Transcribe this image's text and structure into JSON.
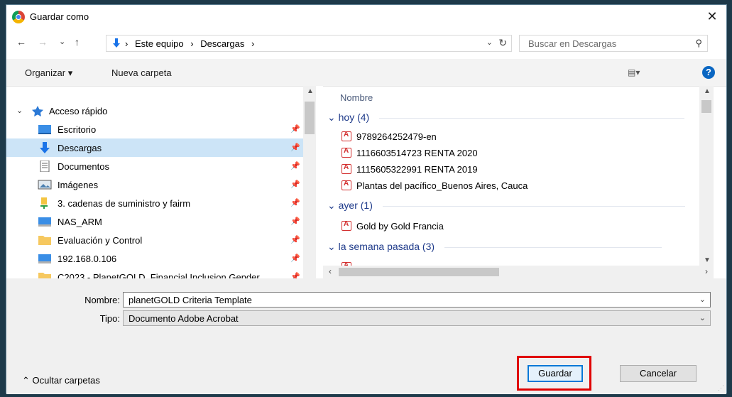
{
  "window": {
    "title": "Guardar como",
    "close_glyph": "✕"
  },
  "nav": {
    "back": "←",
    "forward": "→",
    "recent": "⌄",
    "up": "↑",
    "breadcrumb": [
      "Este equipo",
      "Descargas"
    ],
    "sep": "›",
    "dropdown": "⌄",
    "refresh": "↻"
  },
  "search": {
    "placeholder": "Buscar en Descargas"
  },
  "toolbar": {
    "organize": "Organizar ▾",
    "new_folder": "Nueva carpeta",
    "view": "▤▾",
    "help": "?"
  },
  "sidebar": {
    "quick_access": "Acceso rápido",
    "items": [
      {
        "label": "Escritorio",
        "icon": "desktop-icon"
      },
      {
        "label": "Descargas",
        "icon": "download-folder-icon",
        "selected": true
      },
      {
        "label": "Documentos",
        "icon": "documents-icon"
      },
      {
        "label": "Imágenes",
        "icon": "images-icon"
      },
      {
        "label": "3. cadenas de suministro y fairm",
        "icon": "folder-green-icon"
      },
      {
        "label": "NAS_ARM",
        "icon": "network-drive-icon"
      },
      {
        "label": "Evaluación y Control",
        "icon": "folder-icon"
      },
      {
        "label": "192.168.0.106",
        "icon": "network-drive-icon"
      },
      {
        "label": "C2023 - PlanetGOLD_Financial Inclusion Gender",
        "icon": "folder-icon"
      }
    ]
  },
  "files": {
    "column": "Nombre",
    "groups": [
      {
        "label": "hoy (4)",
        "items": [
          "9789264252479-en",
          "1116603514723 RENTA 2020",
          "1115605322991 RENTA 2019",
          "Plantas del pacífico_Buenos Aires, Cauca"
        ]
      },
      {
        "label": "ayer (1)",
        "items": [
          "Gold by Gold Francia"
        ]
      },
      {
        "label": "la semana pasada (3)",
        "items": []
      }
    ]
  },
  "form": {
    "name_label": "Nombre:",
    "name_value": "planetGOLD Criteria Template",
    "type_label": "Tipo:",
    "type_value": "Documento Adobe Acrobat"
  },
  "footer": {
    "hide_folders": "Ocultar carpetas",
    "save": "Guardar",
    "cancel": "Cancelar"
  },
  "colors": {
    "accent": "#0078d7",
    "selection": "#cce4f7",
    "highlight": "#e00000",
    "pdf": "#d32f2f"
  }
}
